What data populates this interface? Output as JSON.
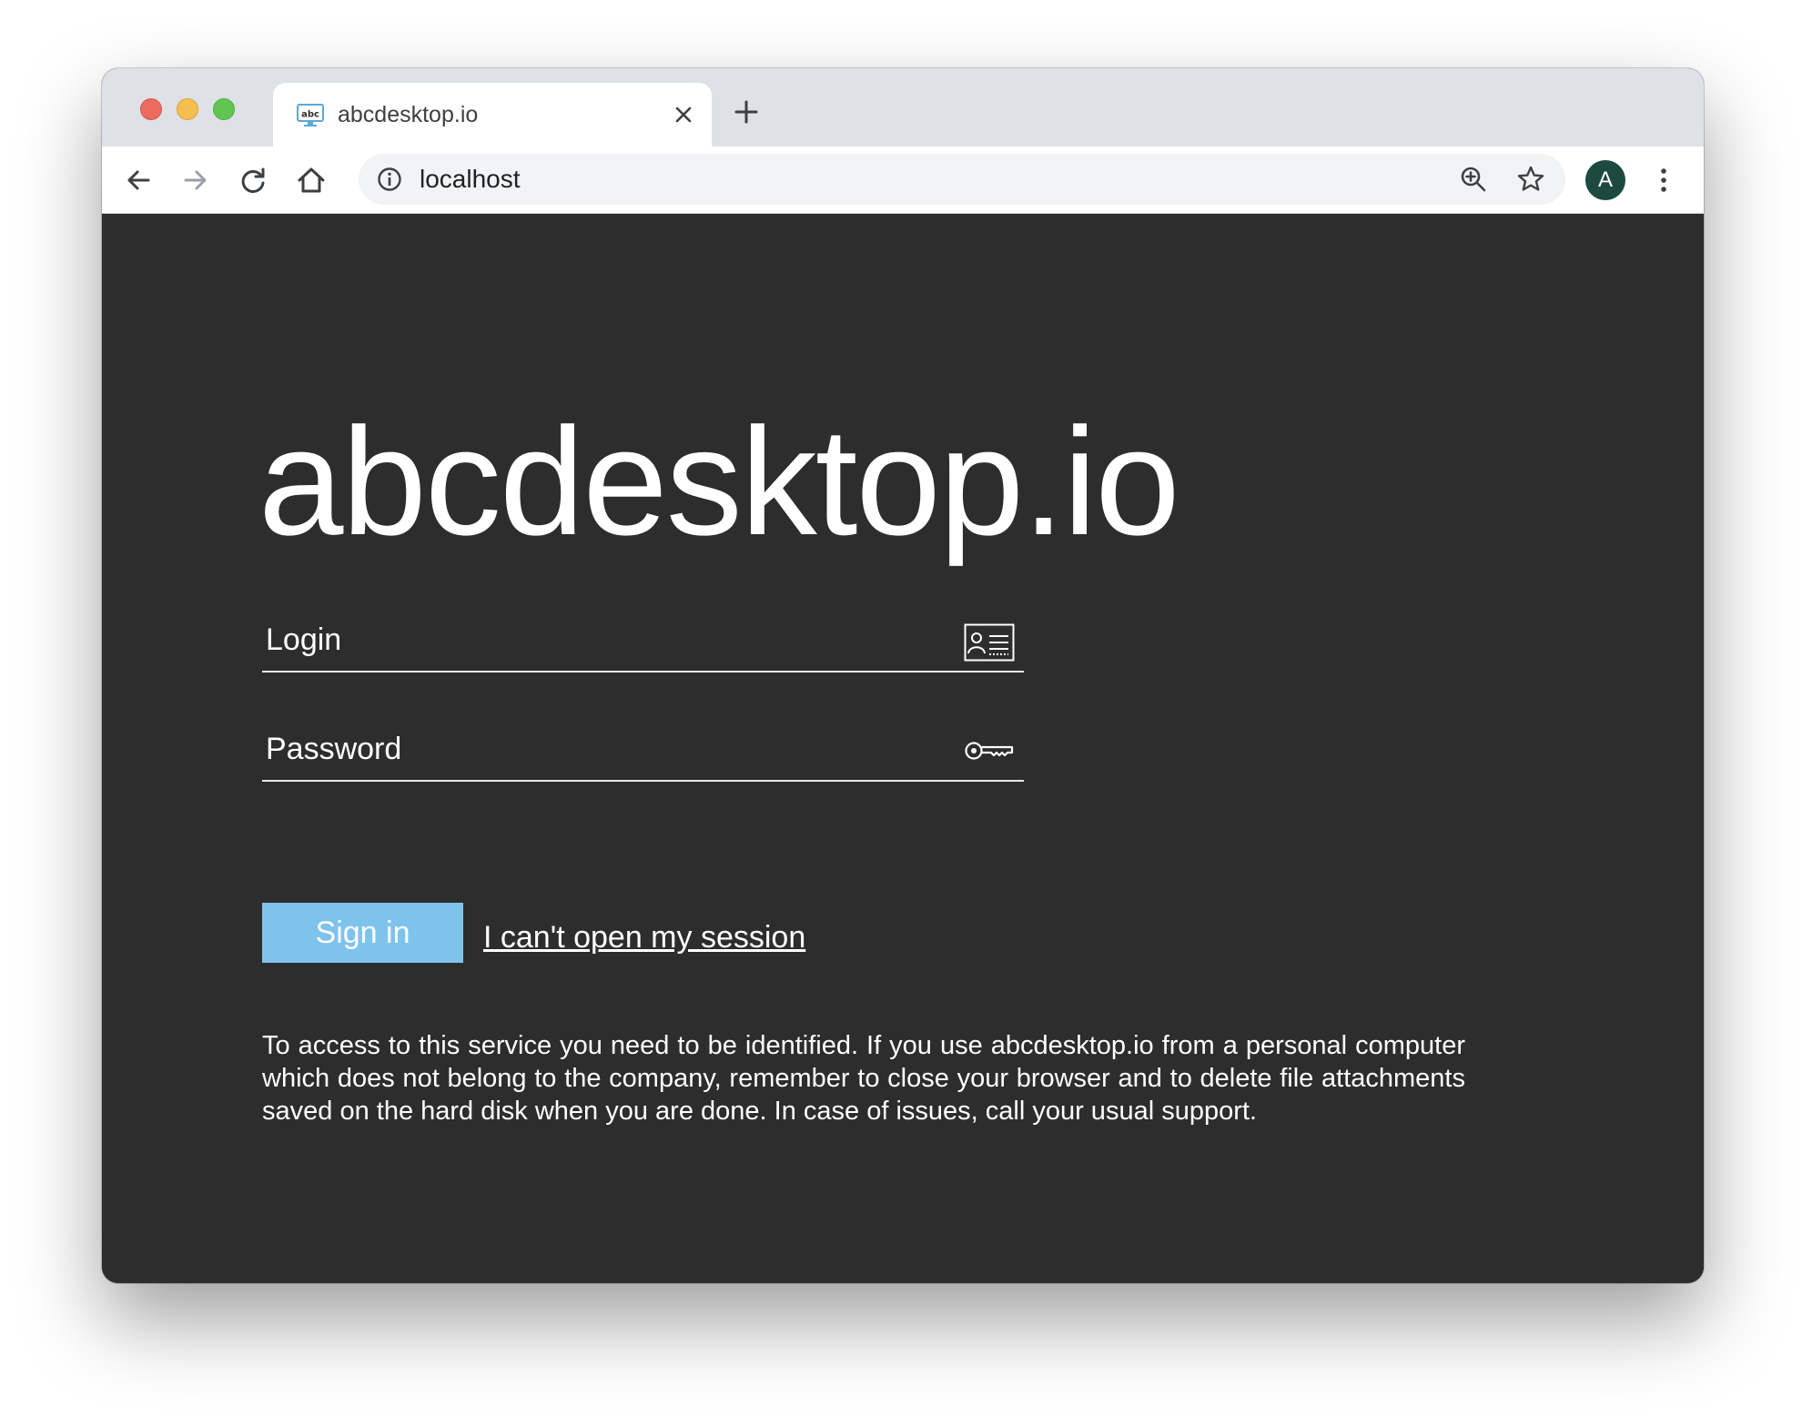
{
  "browser": {
    "tab": {
      "title": "abcdesktop.io",
      "favicon_text": "abc",
      "favicon": "abc-monitor-icon"
    },
    "address_bar": {
      "url": "localhost"
    },
    "profile": {
      "initial": "A"
    },
    "icons": {
      "back": "arrow-left-icon",
      "forward": "arrow-right-icon",
      "reload": "reload-icon",
      "home": "home-icon",
      "info": "info-icon",
      "zoom": "zoom-in-icon",
      "bookmark": "star-icon",
      "menu": "vertical-dots-icon",
      "close": "close-icon",
      "new_tab": "plus-icon"
    }
  },
  "login_page": {
    "brand_title": "abcdesktop.io",
    "login_placeholder": "Login",
    "password_placeholder": "Password",
    "signin_label": "Sign in",
    "help_link": "I can't open my session",
    "notice": "To access to this service you need to be identified. If you use abcdesktop.io from a personal computer which does not belong to the company, remember to close your browser and to delete file attachments saved on the hard disk when you are done. In case of issues, call your usual support.",
    "icons": {
      "login": "id-card-icon",
      "password": "key-icon"
    }
  },
  "colors": {
    "page_background": "#2d2d2d",
    "signin_button": "#7ec3ec",
    "tabstrip": "#dee1e6",
    "avatar": "#1c4a3e"
  }
}
